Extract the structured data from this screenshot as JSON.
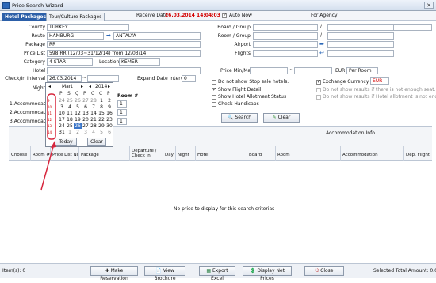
{
  "window": {
    "title": "Price Search Wizard",
    "close": "✕"
  },
  "tabs": [
    "Hotel Packages",
    "Tour/Culture Packages"
  ],
  "receive_date": {
    "label": "Receive Date",
    "value": "26.03.2014 14:04:03"
  },
  "auto_now": "Auto Now",
  "for_agency": "For Agency",
  "fields": {
    "country": {
      "label": "County",
      "value": "TURKEY"
    },
    "route": {
      "label": "Route",
      "from": "HAMBURG",
      "to": "ANTALYA"
    },
    "package": {
      "label": "Package",
      "value": "RR"
    },
    "price_list": {
      "label": "Price List",
      "value": "598.RR (12/03~31/12/14) from 12/03/14"
    },
    "category": {
      "label": "Category",
      "value": "4 STAR"
    },
    "location": {
      "label": "Location",
      "value": "KEMER"
    },
    "hotel": {
      "label": "Hotel",
      "value": ""
    },
    "checkin": {
      "label": "Check/In Interval",
      "value": "26.03.2014",
      "sep": "~"
    },
    "expand": {
      "label": "Expand Date Interval",
      "value": "0"
    },
    "night": {
      "label": "Night"
    },
    "room": {
      "label": "Room #",
      "r1": "1",
      "r2": "1",
      "r3": "1"
    },
    "accommodation_labels": [
      "1.Accommodation",
      "2.Accommodation",
      "3.Accommodation"
    ]
  },
  "right": {
    "board_group": "Board / Group",
    "room_group": "Room / Group",
    "airport": "Airport",
    "flights": "Flights",
    "slash": "/",
    "price_min_max": "Price Min/Max",
    "price_sep": "~",
    "currency": "EUR",
    "per_room": "Per Room",
    "checks": [
      {
        "label": "Do not show Stop sale hotels.",
        "on": false
      },
      {
        "label": "Show Flight Detail",
        "on": true
      },
      {
        "label": "Show Hotel Allotment Status",
        "on": false
      },
      {
        "label": "Check Handicaps",
        "on": false
      }
    ],
    "exchange": {
      "label": "Exchange Currency",
      "value": "EUR",
      "on": true
    },
    "not_enough_seat": "Do not show results if there is not enough seat.",
    "not_enough_allot": "Do not show results if Hotel allotment is not enough.",
    "search": "Search",
    "clear": "Clear"
  },
  "calendar": {
    "month": "Mart",
    "year": "2014",
    "weekdays": [
      "P",
      "S",
      "Ç",
      "P",
      "C",
      "C",
      "P"
    ],
    "weeks": [
      {
        "wk": "9",
        "days": [
          "24",
          "25",
          "26",
          "27",
          "28",
          "1",
          "2"
        ]
      },
      {
        "wk": "10",
        "days": [
          "3",
          "4",
          "5",
          "6",
          "7",
          "8",
          "9"
        ]
      },
      {
        "wk": "11",
        "days": [
          "10",
          "11",
          "12",
          "13",
          "14",
          "15",
          "16"
        ]
      },
      {
        "wk": "12",
        "days": [
          "17",
          "18",
          "19",
          "20",
          "21",
          "22",
          "23"
        ]
      },
      {
        "wk": "13",
        "days": [
          "24",
          "25",
          "26",
          "27",
          "28",
          "29",
          "30"
        ]
      },
      {
        "wk": "14",
        "days": [
          "31",
          "1",
          "2",
          "3",
          "4",
          "5",
          "6"
        ]
      }
    ],
    "today": "Today",
    "clear": "Clear"
  },
  "grid": {
    "top_header": "Accommodation Info",
    "columns": [
      "Choose",
      "Room #",
      "Price List No",
      "Package",
      "Departure / Check In",
      "Day",
      "Night",
      "Hotel",
      "Board",
      "Room",
      "Accommodation",
      "Dep. Flight"
    ],
    "empty": "No price to display for this search criterias"
  },
  "bottom": {
    "items": "Item(s): 0",
    "make_reservation": "Make Reservation",
    "view_brochure": "View Brochure",
    "export_excel": "Export Excel",
    "display_net": "Display Net Prices",
    "close": "Close",
    "total": "Selected Total Amount: 0.00"
  },
  "colors": {
    "accent": "#2c5fa8",
    "red": "#d40000",
    "annotation": "#d7263d"
  }
}
